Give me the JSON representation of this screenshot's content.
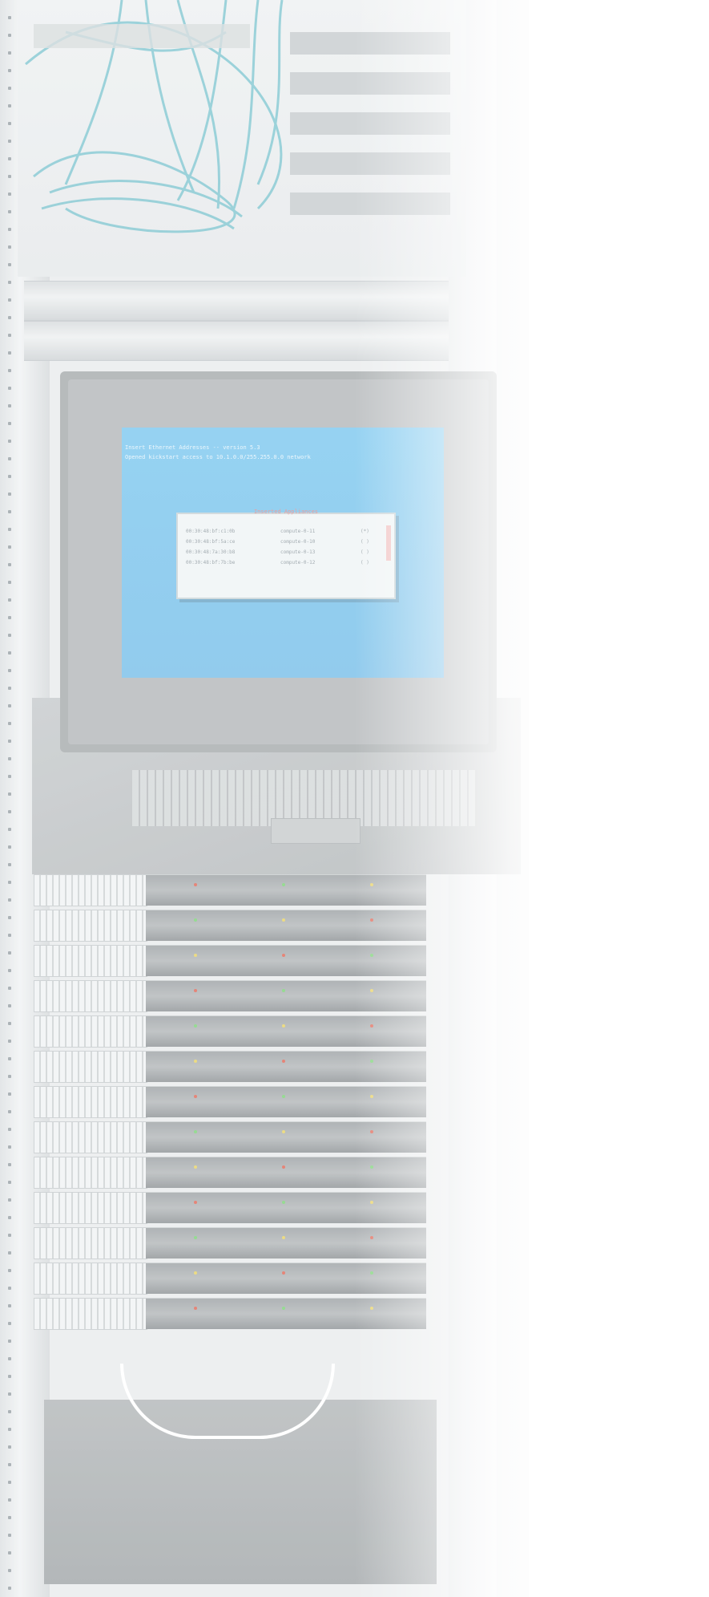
{
  "image": {
    "subject": "server rack with pull-out console monitor",
    "colors": {
      "background": "#ffffff",
      "screen": "#7fc5ed",
      "dialog_title": "#e88a88",
      "cable": "#7cc4cf"
    }
  },
  "screen": {
    "line1": "Insert Ethernet Addresses -- version 5.3",
    "line2": "Opened kickstart access to 10.1.0.0/255.255.0.0 network",
    "dialog": {
      "title": "Inserted Appliances",
      "rows": [
        {
          "mac": "00:30:48:bf:c1:0b",
          "name": "compute-0-11",
          "status": "(*)"
        },
        {
          "mac": "00:30:48:bf:5a:ce",
          "name": "compute-0-10",
          "status": "( )"
        },
        {
          "mac": "00:30:48:7a:30:b8",
          "name": "compute-0-13",
          "status": "( )"
        },
        {
          "mac": "00:30:48:bf:7b:be",
          "name": "compute-0-12",
          "status": "( )"
        }
      ]
    }
  }
}
